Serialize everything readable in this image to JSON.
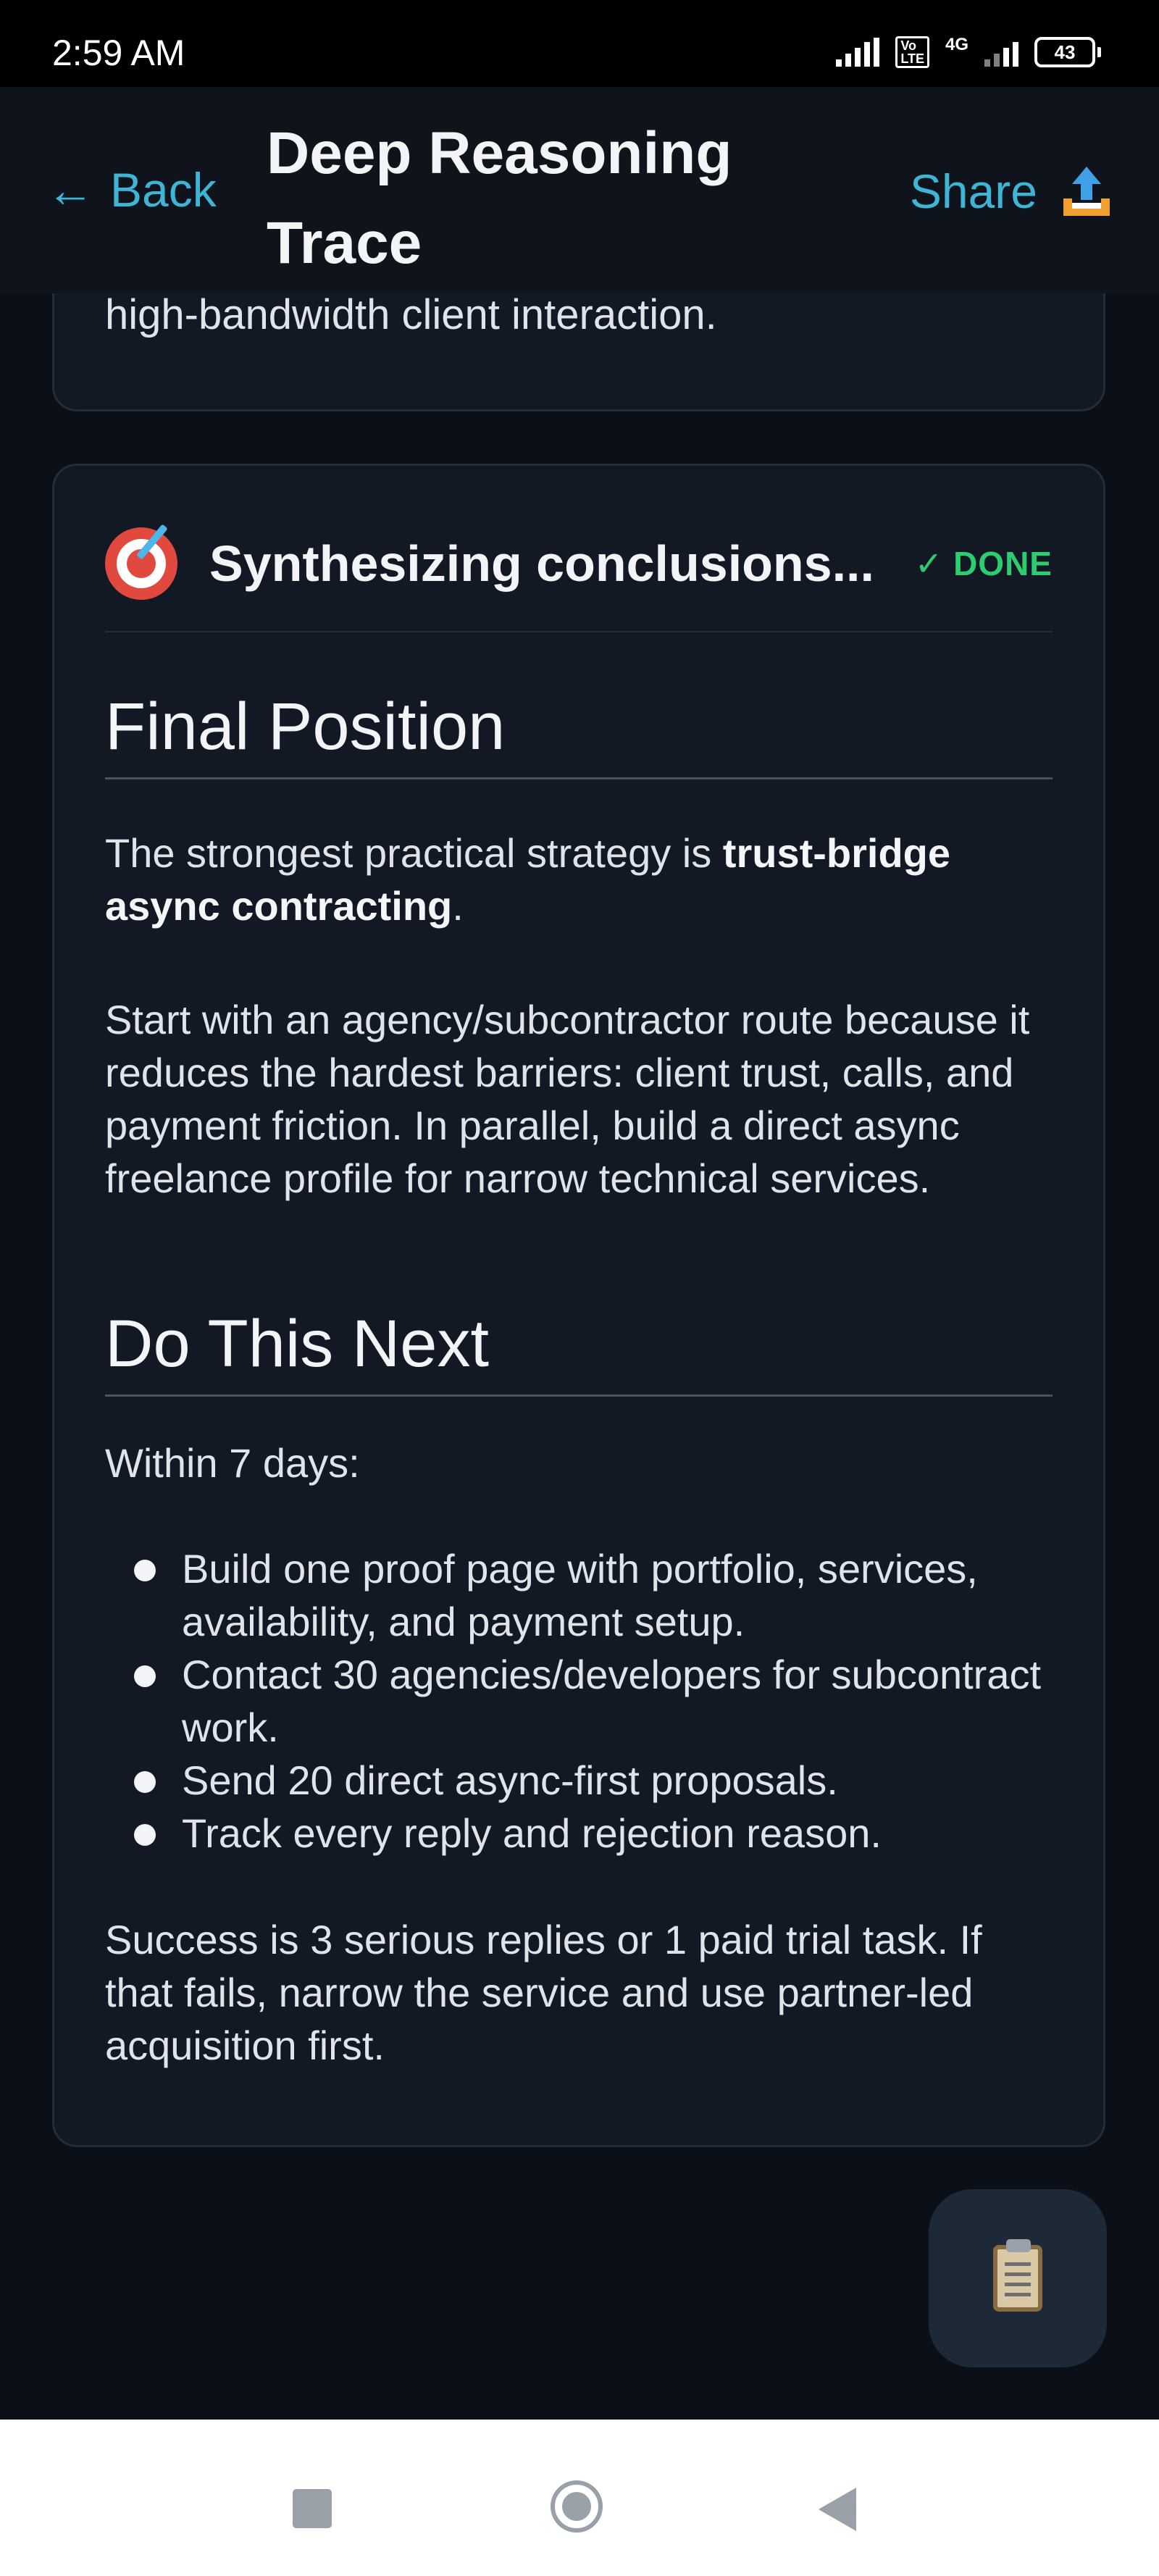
{
  "status_bar": {
    "time": "2:59 AM",
    "volte": "Vo LTE",
    "network": "4G",
    "battery": "43"
  },
  "header": {
    "back_label": "Back",
    "back_arrow": "←",
    "title_line1": "Deep Reasoning",
    "title_line2": "Trace",
    "share_label": "Share",
    "share_icon": "share-upload-icon"
  },
  "previous_step": {
    "tail_text": "high-bandwidth client interaction."
  },
  "step": {
    "icon": "target-icon",
    "title": "Synthesizing conclusions...",
    "status": "✓ DONE",
    "status_color": "#2ecc71"
  },
  "final_position": {
    "heading": "Final Position",
    "p1_prefix": "The strongest practical strategy is ",
    "p1_bold": "trust-bridge async contracting",
    "p1_suffix": ".",
    "p2": "Start with an agency/subcontractor route because it reduces the hardest barriers: client trust, calls, and payment friction. In parallel, build a direct async freelance profile for narrow technical services."
  },
  "do_this_next": {
    "heading": "Do This Next",
    "intro": "Within 7 days:",
    "items": [
      "Build one proof page with portfolio, services, availability, and payment setup.",
      "Contact 30 agencies/developers for subcontract work.",
      "Send 20 direct async-first proposals.",
      "Track every reply and rejection reason."
    ],
    "closing": "Success is 3 serious replies or 1 paid trial task. If that fails, narrow the service and use partner-led acquisition first."
  },
  "fab": {
    "icon": "clipboard-icon"
  },
  "colors": {
    "accent": "#3fb5d6",
    "background": "#0b0f17",
    "card": "#121924"
  }
}
